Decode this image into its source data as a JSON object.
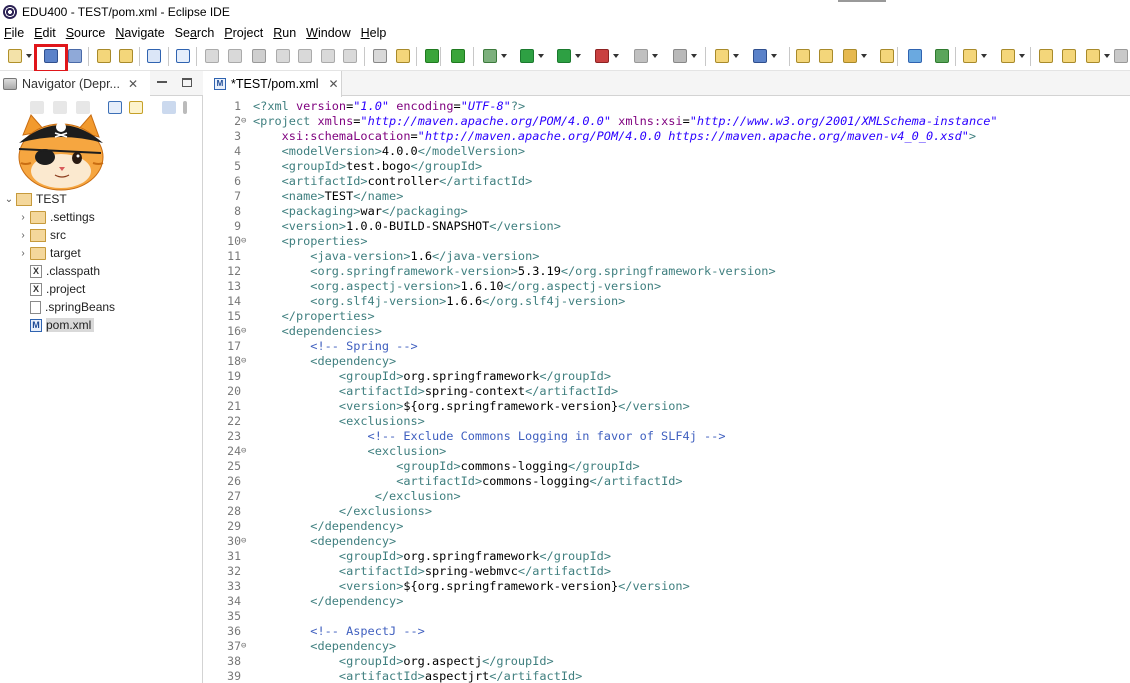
{
  "window": {
    "title": "EDU400 - TEST/pom.xml - Eclipse IDE"
  },
  "menu": [
    {
      "label": "File",
      "mnemonic": "F"
    },
    {
      "label": "Edit",
      "mnemonic": "E"
    },
    {
      "label": "Source",
      "mnemonic": "S"
    },
    {
      "label": "Navigate",
      "mnemonic": "N"
    },
    {
      "label": "Search",
      "mnemonic": "a"
    },
    {
      "label": "Project",
      "mnemonic": "P"
    },
    {
      "label": "Run",
      "mnemonic": "R"
    },
    {
      "label": "Window",
      "mnemonic": "W"
    },
    {
      "label": "Help",
      "mnemonic": "H"
    }
  ],
  "colors": {
    "highlight": "#e0161a",
    "xml_tag": "#3f7f7f",
    "xml_attr": "#7f007f",
    "xml_string": "#2a00ff",
    "xml_comment": "#3f5fbf"
  },
  "navigator": {
    "tab_label": "Navigator (Depr...",
    "tree": [
      {
        "label": "TEST",
        "type": "project",
        "expanded": true,
        "depth": 0
      },
      {
        "label": ".settings",
        "type": "folder",
        "depth": 1
      },
      {
        "label": "src",
        "type": "src-folder",
        "depth": 1
      },
      {
        "label": "target",
        "type": "folder",
        "depth": 1
      },
      {
        "label": ".classpath",
        "type": "x-file",
        "depth": 1
      },
      {
        "label": ".project",
        "type": "x-file",
        "depth": 1
      },
      {
        "label": ".springBeans",
        "type": "file",
        "depth": 1
      },
      {
        "label": "pom.xml",
        "type": "m-file",
        "depth": 1,
        "selected": true
      }
    ]
  },
  "editor": {
    "tab_label": "*TEST/pom.xml",
    "lines": [
      {
        "n": "1",
        "fold": "",
        "code": "<?xml version=\"1.0\" encoding=\"UTF-8\"?>"
      },
      {
        "n": "2",
        "fold": "⊖",
        "code": "<project xmlns=\"http://maven.apache.org/POM/4.0.0\" xmlns:xsi=\"http://www.w3.org/2001/XMLSchema-instance\""
      },
      {
        "n": "3",
        "fold": "",
        "code": "    xsi:schemaLocation=\"http://maven.apache.org/POM/4.0.0 https://maven.apache.org/maven-v4_0_0.xsd\">"
      },
      {
        "n": "4",
        "fold": "",
        "code": "    <modelVersion>4.0.0</modelVersion>"
      },
      {
        "n": "5",
        "fold": "",
        "code": "    <groupId>test.bogo</groupId>"
      },
      {
        "n": "6",
        "fold": "",
        "code": "    <artifactId>controller</artifactId>"
      },
      {
        "n": "7",
        "fold": "",
        "code": "    <name>TEST</name>"
      },
      {
        "n": "8",
        "fold": "",
        "code": "    <packaging>war</packaging>"
      },
      {
        "n": "9",
        "fold": "",
        "code": "    <version>1.0.0-BUILD-SNAPSHOT</version>"
      },
      {
        "n": "10",
        "fold": "⊖",
        "code": "    <properties>"
      },
      {
        "n": "11",
        "fold": "",
        "code": "        <java-version>1.6</java-version>"
      },
      {
        "n": "12",
        "fold": "",
        "code": "        <org.springframework-version>5.3.19</org.springframework-version>"
      },
      {
        "n": "13",
        "fold": "",
        "code": "        <org.aspectj-version>1.6.10</org.aspectj-version>"
      },
      {
        "n": "14",
        "fold": "",
        "code": "        <org.slf4j-version>1.6.6</org.slf4j-version>"
      },
      {
        "n": "15",
        "fold": "",
        "code": "    </properties>"
      },
      {
        "n": "16",
        "fold": "⊖",
        "code": "    <dependencies>"
      },
      {
        "n": "17",
        "fold": "",
        "code": "        <!-- Spring -->"
      },
      {
        "n": "18",
        "fold": "⊖",
        "code": "        <dependency>"
      },
      {
        "n": "19",
        "fold": "",
        "code": "            <groupId>org.springframework</groupId>"
      },
      {
        "n": "20",
        "fold": "",
        "code": "            <artifactId>spring-context</artifactId>"
      },
      {
        "n": "21",
        "fold": "",
        "code": "            <version>${org.springframework-version}</version>"
      },
      {
        "n": "22",
        "fold": "",
        "code": "            <exclusions>"
      },
      {
        "n": "23",
        "fold": "",
        "code": "                <!-- Exclude Commons Logging in favor of SLF4j -->"
      },
      {
        "n": "24",
        "fold": "⊖",
        "code": "                <exclusion>"
      },
      {
        "n": "25",
        "fold": "",
        "code": "                    <groupId>commons-logging</groupId>"
      },
      {
        "n": "26",
        "fold": "",
        "code": "                    <artifactId>commons-logging</artifactId>"
      },
      {
        "n": "27",
        "fold": "",
        "code": "                 </exclusion>"
      },
      {
        "n": "28",
        "fold": "",
        "code": "            </exclusions>"
      },
      {
        "n": "29",
        "fold": "",
        "code": "        </dependency>"
      },
      {
        "n": "30",
        "fold": "⊖",
        "code": "        <dependency>"
      },
      {
        "n": "31",
        "fold": "",
        "code": "            <groupId>org.springframework</groupId>"
      },
      {
        "n": "32",
        "fold": "",
        "code": "            <artifactId>spring-webmvc</artifactId>"
      },
      {
        "n": "33",
        "fold": "",
        "code": "            <version>${org.springframework-version}</version>"
      },
      {
        "n": "34",
        "fold": "",
        "code": "        </dependency>"
      },
      {
        "n": "35",
        "fold": "",
        "code": ""
      },
      {
        "n": "36",
        "fold": "",
        "code": "        <!-- AspectJ -->"
      },
      {
        "n": "37",
        "fold": "⊖",
        "code": "        <dependency>"
      },
      {
        "n": "38",
        "fold": "",
        "code": "            <groupId>org.aspectj</groupId>"
      },
      {
        "n": "39",
        "fold": "",
        "code": "            <artifactId>aspectjrt</artifactId>"
      }
    ]
  }
}
